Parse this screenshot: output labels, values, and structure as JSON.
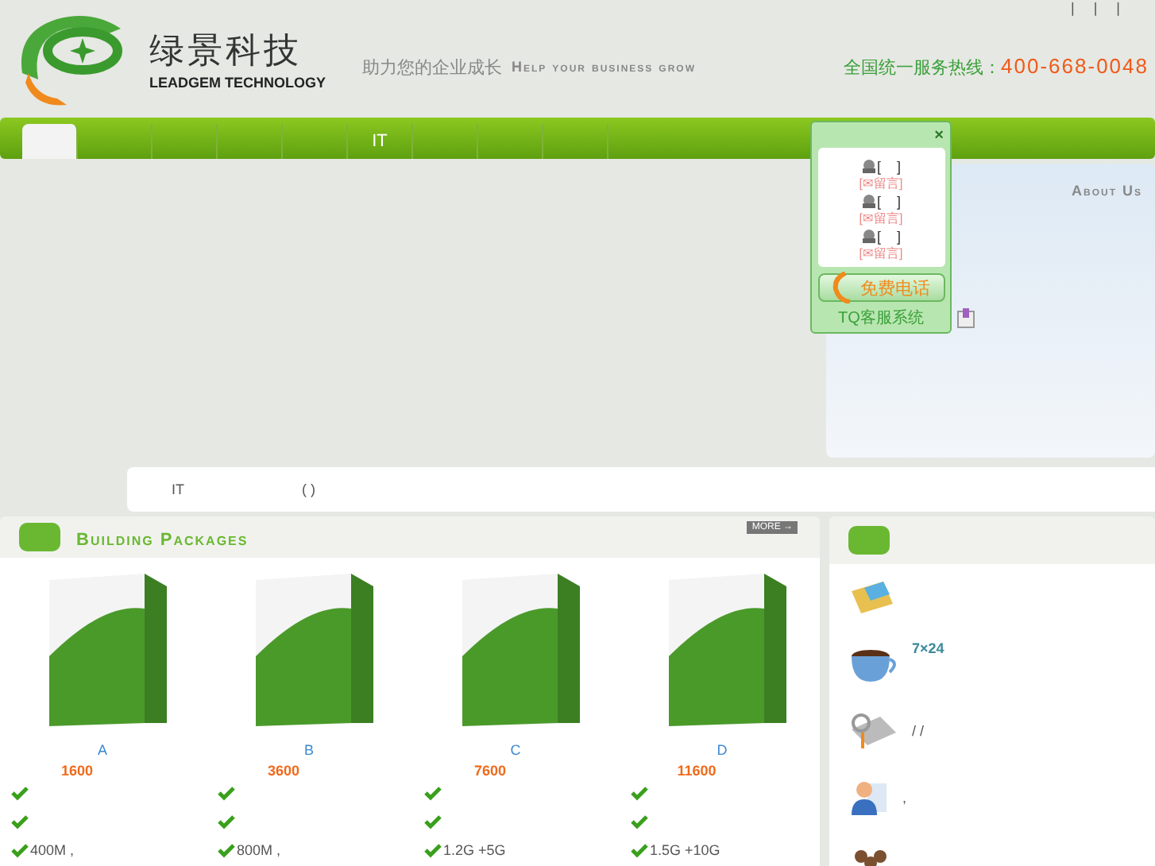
{
  "header": {
    "logo_cn": "绿景科技",
    "logo_en": "LEADGEM TECHNOLOGY",
    "slogan_cn": "助力您的企业成长",
    "slogan_en": "Help your business grow",
    "hotline_label": "全国统一服务热线：",
    "hotline": "400-668-0048",
    "top_links": [
      "|",
      "|",
      "|"
    ]
  },
  "nav": [
    {
      "selected": true
    },
    {
      "selected": false
    },
    {
      "selected": false
    },
    {
      "selected": false
    },
    {
      "selected": false
    },
    {
      "label": "IT",
      "selected": false
    },
    {
      "selected": false
    },
    {
      "selected": false
    },
    {
      "selected": false
    }
  ],
  "chat_widget": {
    "close": "×",
    "agents": [
      {
        "kind": "agent",
        "text": "[    ]"
      },
      {
        "kind": "message",
        "text": "[✉留言]"
      },
      {
        "kind": "agent",
        "text": "[    ]"
      },
      {
        "kind": "message",
        "text": "[✉留言]"
      },
      {
        "kind": "agent",
        "text": "[    ]"
      },
      {
        "kind": "message",
        "text": "[✉留言]"
      }
    ],
    "call_button": "免费电话",
    "footer": "TQ客服系统"
  },
  "about": {
    "title": "About Us"
  },
  "notice": {
    "items": [
      "IT",
      "( )"
    ]
  },
  "packages": {
    "title": "Building Packages",
    "more": "MORE →",
    "items": [
      {
        "name": "A",
        "price": "1600",
        "features": [
          {
            "kind": "check"
          },
          {
            "kind": "check"
          },
          {
            "kind": "check",
            "text": "400M ,"
          }
        ]
      },
      {
        "name": "B",
        "price": "3600",
        "features": [
          {
            "kind": "check"
          },
          {
            "kind": "check"
          },
          {
            "kind": "check",
            "text": "800M ,"
          }
        ]
      },
      {
        "name": "C",
        "price": "7600",
        "features": [
          {
            "kind": "check"
          },
          {
            "kind": "check"
          },
          {
            "kind": "check",
            "text": "1.2G +5G"
          }
        ]
      },
      {
        "name": "D",
        "price": "11600",
        "features": [
          {
            "kind": "check"
          },
          {
            "kind": "check"
          },
          {
            "kind": "check",
            "text": "1.5G +10G"
          }
        ]
      }
    ]
  },
  "services": [
    {
      "kind": "card"
    },
    {
      "kind": "cup",
      "text": "7×24"
    },
    {
      "kind": "newspaper",
      "text": "/ /"
    },
    {
      "kind": "person",
      "text": ","
    },
    {
      "kind": "group"
    }
  ]
}
